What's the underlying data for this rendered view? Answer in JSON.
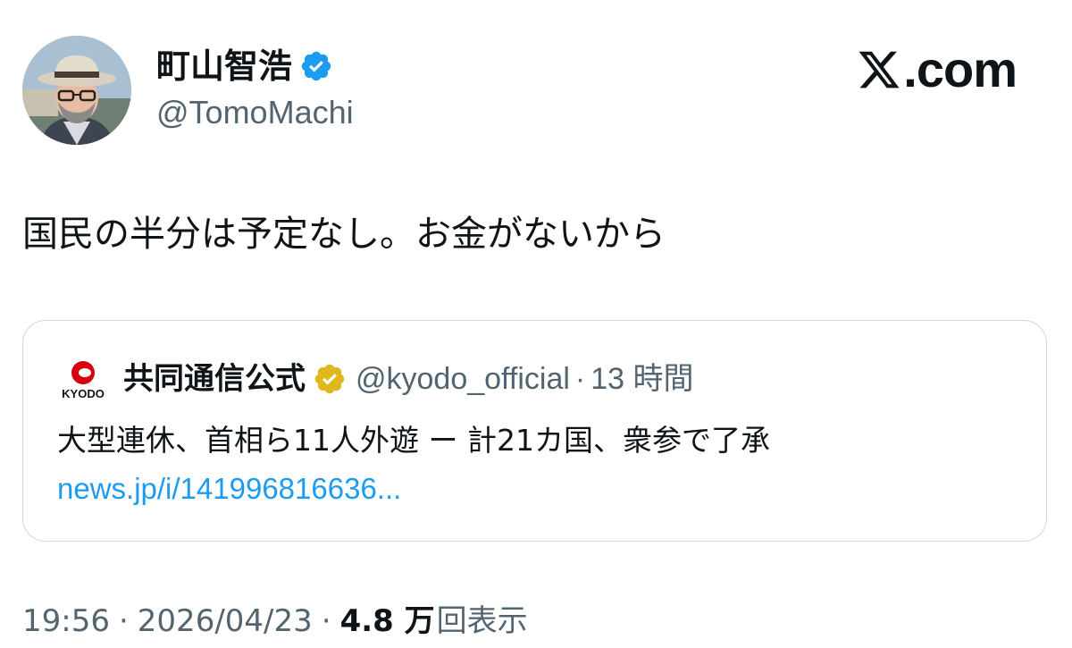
{
  "author": {
    "display_name": "町山智浩",
    "handle": "@TomoMachi",
    "avatar_icon": "profile-photo-man-in-hat",
    "verified_icon": "blue-verified-badge"
  },
  "brand": {
    "icon": "x-logo-icon",
    "suffix": ".com"
  },
  "tweet": {
    "text": "国民の半分は予定なし。お金がないから"
  },
  "quote": {
    "logo_text": "KYODO",
    "display_name": "共同通信公式",
    "verified_icon": "gold-verified-badge",
    "handle": "@kyodo_official",
    "separator": "·",
    "time": "13 時間",
    "text": "大型連休、首相ら11人外遊 ー 計21カ国、衆参で了承",
    "link": "news.jp/i/141996816636..."
  },
  "meta": {
    "time": "19:56",
    "separator": "·",
    "date": "2026/04/23",
    "views_count": "4.8 万",
    "views_label": "回表示"
  },
  "colors": {
    "text_primary": "#0f1419",
    "text_secondary": "#536471",
    "link": "#1d9bf0",
    "border": "#cfd9de",
    "verified_blue": "#1d9bf0",
    "verified_gold": "#e2b719",
    "kyodo_red": "#d7000f"
  }
}
